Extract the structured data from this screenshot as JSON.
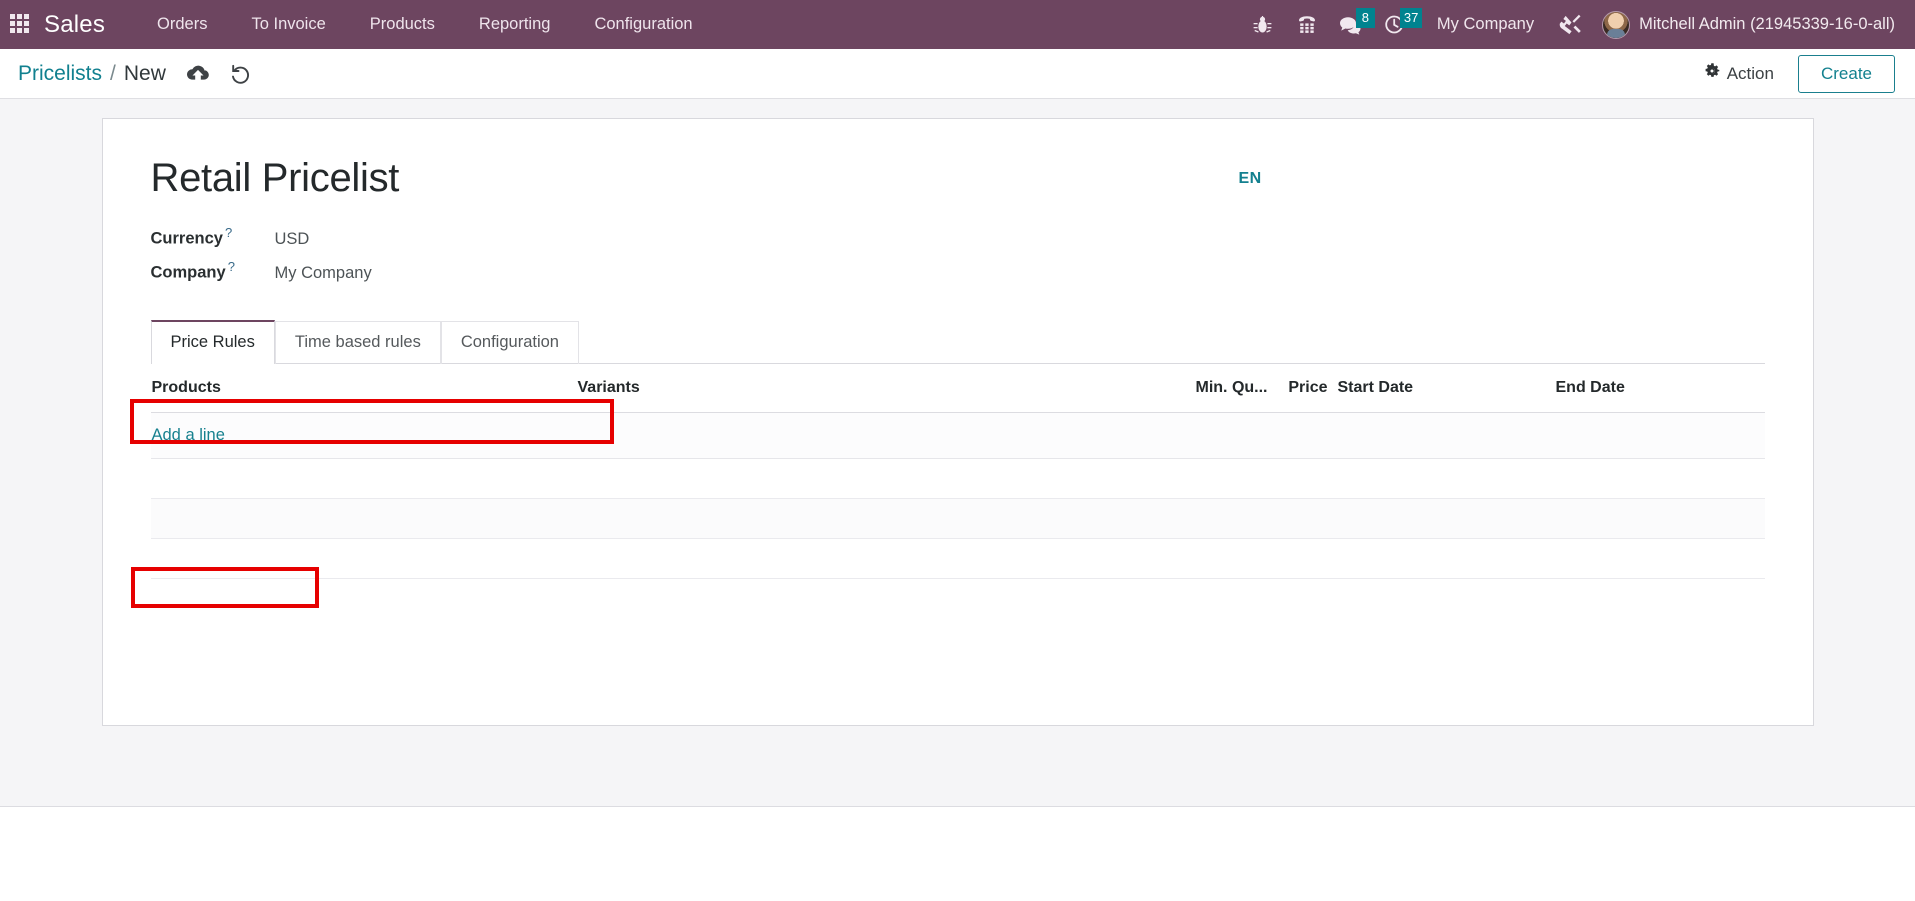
{
  "navbar": {
    "apps_icon": "apps-grid-icon",
    "brand": "Sales",
    "menu": [
      {
        "label": "Orders"
      },
      {
        "label": "To Invoice"
      },
      {
        "label": "Products"
      },
      {
        "label": "Reporting"
      },
      {
        "label": "Configuration"
      }
    ],
    "icons": [
      {
        "name": "bug-icon",
        "badge": null
      },
      {
        "name": "phone-dialpad-icon",
        "badge": null
      },
      {
        "name": "messaging-chat-icon",
        "badge": "8"
      },
      {
        "name": "activities-clock-icon",
        "badge": "37"
      }
    ],
    "company_switcher": "My Company",
    "tools_icon": "tools-wrench-screwdriver-icon",
    "user": "Mitchell Admin (21945339-16-0-all)",
    "badge_color": "#00838f",
    "background_color": "#6d4560"
  },
  "control_panel": {
    "breadcrumb_root": "Pricelists",
    "breadcrumb_separator": "/",
    "breadcrumb_current": "New",
    "save_icon": "cloud-upload-save-icon",
    "discard_icon": "undo-discard-icon",
    "action_icon": "gear-icon",
    "action_label": "Action",
    "create_label": "Create",
    "accent_color": "#13818f"
  },
  "form": {
    "title": "Retail Pricelist",
    "language_badge": "EN",
    "fields": [
      {
        "label": "Currency",
        "help": "?",
        "value": "USD"
      },
      {
        "label": "Company",
        "help": "?",
        "value": "My Company"
      }
    ],
    "tabs": [
      {
        "label": "Price Rules",
        "active": true
      },
      {
        "label": "Time based rules",
        "active": false
      },
      {
        "label": "Configuration",
        "active": false
      }
    ],
    "table": {
      "columns": [
        "Products",
        "Variants",
        "Min. Qu...",
        "Price",
        "Start Date",
        "End Date"
      ],
      "rows": [],
      "add_line_label": "Add a line"
    },
    "highlights": [
      {
        "name": "company-field-highlight",
        "color": "#e60000"
      },
      {
        "name": "add-a-line-highlight",
        "color": "#e60000"
      }
    ]
  }
}
